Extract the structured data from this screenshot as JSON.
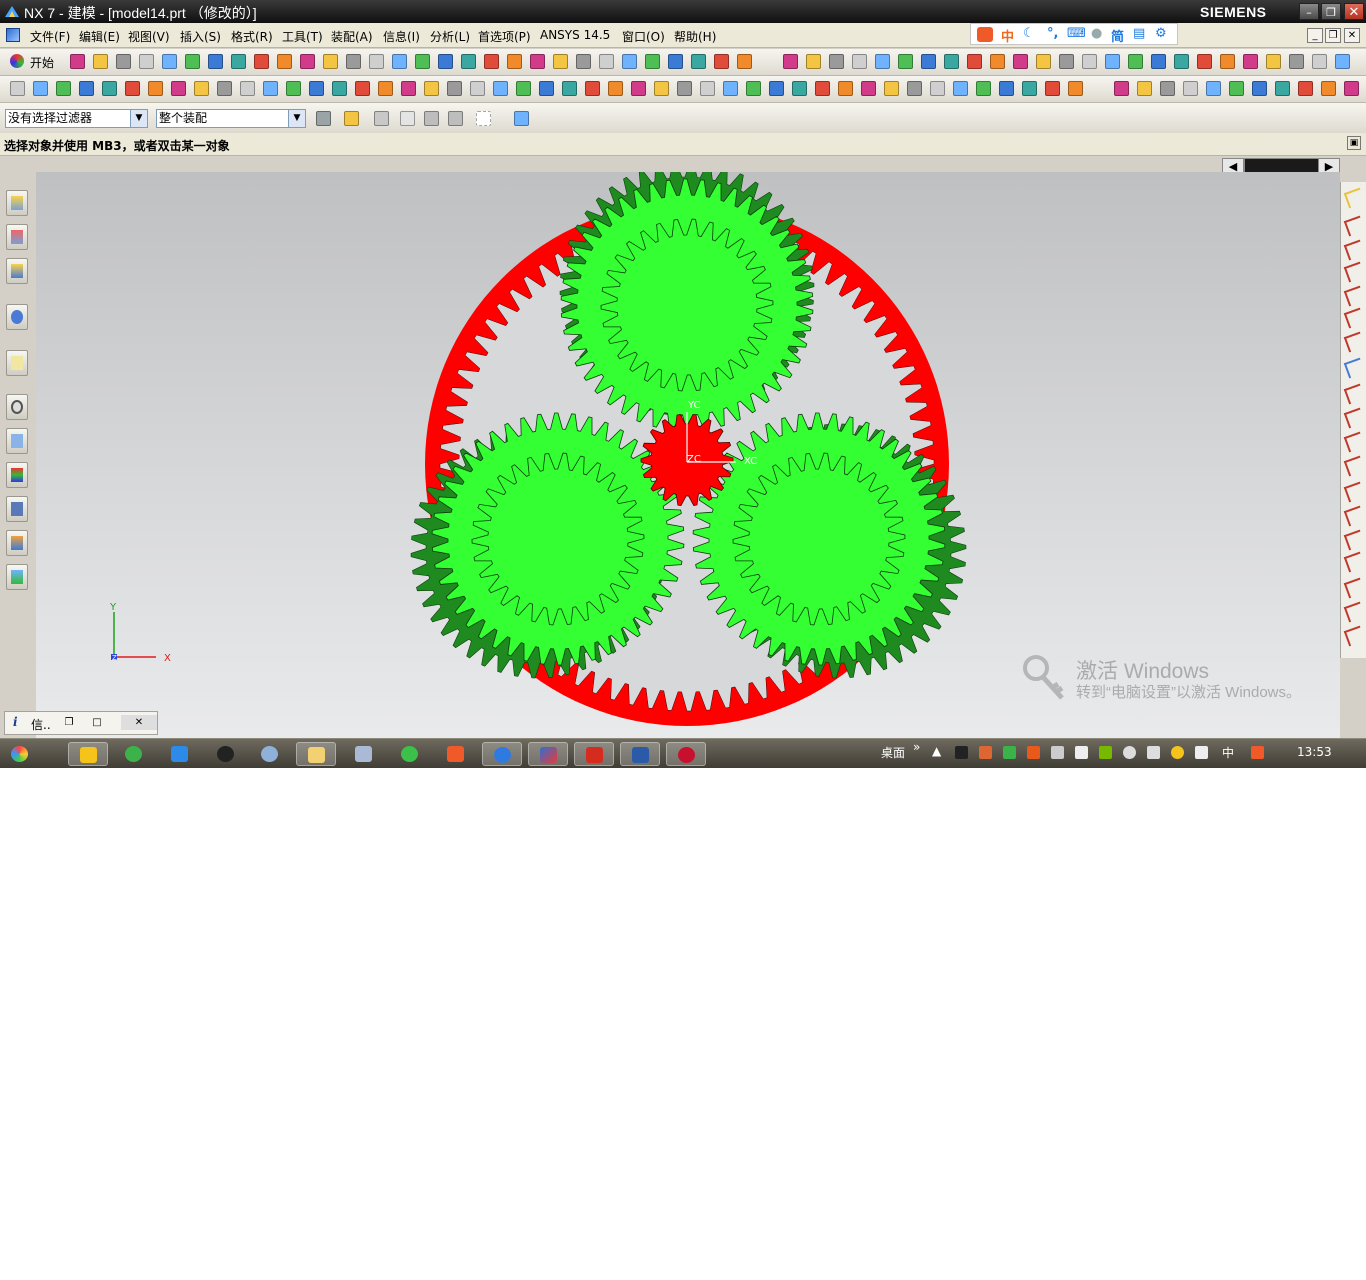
{
  "window": {
    "title": "NX 7 - 建模 - [model14.prt （修改的）]",
    "brand": "SIEMENS"
  },
  "menu": [
    "文件(F)",
    "编辑(E)",
    "视图(V)",
    "插入(S)",
    "格式(R)",
    "工具(T)",
    "装配(A)",
    "信息(I)",
    "分析(L)",
    "首选项(P)",
    "ANSYS 14.5",
    "窗口(O)",
    "帮助(H)"
  ],
  "ime": {
    "chinese": "中",
    "simplified": "简"
  },
  "toolbar": {
    "start_label": "开始"
  },
  "selection": {
    "filter_value": "没有选择过滤器",
    "scope_value": "整个装配"
  },
  "cue_line": "选择对象并使用 MB3，或者双击某一对象",
  "viewport": {
    "wcs_labels": {
      "yc": "YC",
      "xc": "XC",
      "zc": "ZC"
    },
    "triad_labels": {
      "x": "X",
      "y": "Y",
      "z": "Z"
    },
    "colors": {
      "ring_gear": "#ff0000",
      "planet_gear": "#33ff33",
      "sun_gear": "#ff0000",
      "background": "#d7d8da"
    }
  },
  "watermark": {
    "line1": "激活 Windows",
    "line2": "转到“电脑设置”以激活 Windows。"
  },
  "info_window": {
    "label": "信.."
  },
  "taskbar": {
    "desktop_label": "桌面",
    "tray_ime": "中",
    "clock": "13:53"
  }
}
